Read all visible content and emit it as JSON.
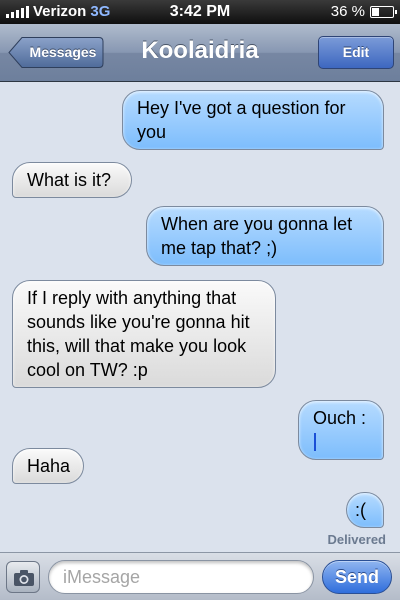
{
  "status_bar": {
    "carrier": "Verizon",
    "network": "3G",
    "time": "3:42 PM",
    "battery_percent": "36 %",
    "battery_level": 0.36
  },
  "nav": {
    "back_label": "Messages",
    "title": "Koolaidria",
    "edit_label": "Edit"
  },
  "messages": [
    {
      "side": "sent",
      "text": "Hey I've got a question for you"
    },
    {
      "side": "received",
      "text": "What is it?"
    },
    {
      "side": "sent",
      "text": "When are you gonna let me tap that? ;)"
    },
    {
      "side": "received",
      "text": "If I reply with anything that sounds like you're gonna hit this, will that make you look cool on TW? :p"
    },
    {
      "side": "sent",
      "text": "Ouch :"
    },
    {
      "side": "received",
      "text": "Haha"
    },
    {
      "side": "sent",
      "text": ":("
    }
  ],
  "delivered_label": "Delivered",
  "input": {
    "placeholder": "iMessage",
    "send_label": "Send"
  },
  "colors": {
    "sent_bubble": "#8fc6fd",
    "received_bubble": "#e6e6e6",
    "background": "#dbe2ed",
    "accent": "#2f6edc"
  }
}
